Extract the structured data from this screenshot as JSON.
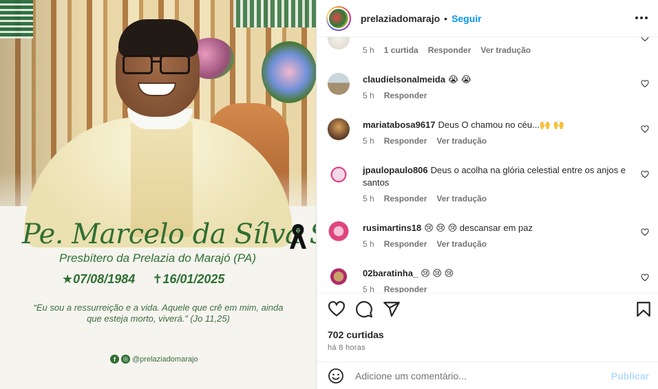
{
  "post": {
    "image": {
      "name": "Pe. Marcelo da Sílva Souza",
      "role": "Presbítero da Prelazia do Marajó (PA)",
      "birth": "★07/08/1984",
      "death": "✝16/01/2025",
      "quote": "“Eu sou a ressurreição e a vida. Aquele que crê em mim, ainda que esteja morto, viverá.” (Jo 11,25)",
      "handle": "@prelaziadomarajo",
      "social_icons": [
        "facebook-icon",
        "instagram-icon"
      ]
    }
  },
  "header": {
    "username": "prelaziadomarajo",
    "separator": "•",
    "follow_label": "Seguir"
  },
  "comments": [
    {
      "username": "",
      "text": "",
      "time": "5 h",
      "likes": "1 curtida",
      "reply": "Responder",
      "translate": "Ver tradução"
    },
    {
      "username": "claudielsonalmeida",
      "text": "😭 😭",
      "time": "5 h",
      "reply": "Responder"
    },
    {
      "username": "mariatabosa9617",
      "text": "Deus O chamou no céu...🙌 🙌",
      "time": "5 h",
      "reply": "Responder",
      "translate": "Ver tradução"
    },
    {
      "username": "jpaulopaulo806",
      "text": "Deus o acolha na glória celestial entre os anjos e santos",
      "time": "5 h",
      "reply": "Responder",
      "translate": "Ver tradução"
    },
    {
      "username": "rusimartins18",
      "text": "😢 😢 😢 descansar em paz",
      "time": "5 h",
      "reply": "Responder",
      "translate": "Ver tradução"
    },
    {
      "username": "02baratinha_",
      "text": "😢 😢 😢",
      "time": "5 h",
      "reply": "Responder"
    }
  ],
  "actions": {
    "likes": "702 curtidas",
    "time_ago": "há 8 horas"
  },
  "add_comment": {
    "placeholder": "Adicione um comentário...",
    "publish_label": "Publicar"
  },
  "colors": {
    "accent": "#0095f6",
    "publish_disabled": "#b3dbff",
    "image_green": "#2f6e33"
  }
}
